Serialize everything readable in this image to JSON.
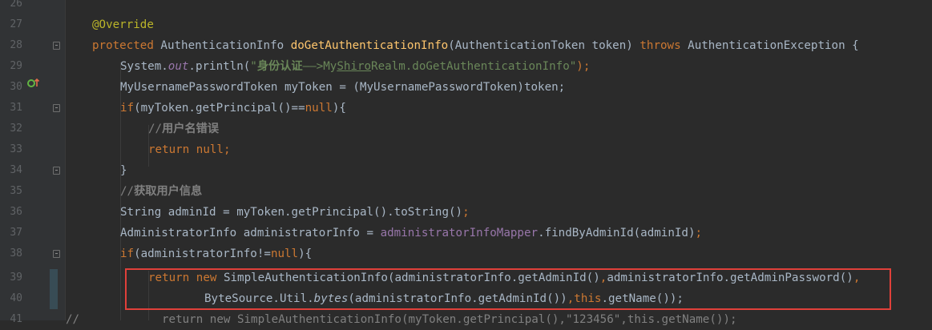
{
  "editor": {
    "line_numbers": [
      "26",
      "27",
      "28",
      "29",
      "30",
      "31",
      "32",
      "33",
      "34",
      "35",
      "36",
      "37",
      "38",
      "39",
      "40",
      "41"
    ],
    "lines": {
      "l27": {
        "annotation": "@Override"
      },
      "l28": {
        "kw": "protected",
        "type": "AuthenticationInfo",
        "method": "doGetAuthenticationInfo",
        "params": "(AuthenticationToken token)",
        "throws": "throws",
        "exc": "AuthenticationException {"
      },
      "l29": {
        "pre": "System.",
        "field": "out",
        "call": ".println(",
        "str_q": "\"",
        "str_cjk": "身份认证",
        "str_arrow": "——>My",
        "str_ul": "Shiro",
        "str_rest": "Realm.doGetAuthenticationInfo\"",
        "end": ");"
      },
      "l30": {
        "text": "MyUsernamePasswordToken myToken = (MyUsernamePasswordToken)token;"
      },
      "l31": {
        "kw": "if",
        "mid": "(myToken.getPrincipal()==",
        "null": "null",
        "end": "){"
      },
      "l32": {
        "slashes": "//",
        "cjk": "用户名错误"
      },
      "l33": {
        "text": "return null;"
      },
      "l34": {
        "text": "}"
      },
      "l35": {
        "slashes": "//",
        "cjk": "获取用户信息"
      },
      "l36": {
        "pre": "String adminId = myToken.getPrincipal().toString()",
        "end": ";"
      },
      "l37": {
        "pre": "AdministratorInfo administratorInfo = ",
        "field": "administratorInfoMapper",
        "post": ".findByAdminId(adminId)",
        "end": ";"
      },
      "l38": {
        "kw": "if",
        "mid": "(administratorInfo!=",
        "null": "null",
        "end": "){"
      },
      "l39": {
        "ret": "return",
        "new": "new",
        "a": " SimpleAuthenticationInfo(administratorInfo.getAdminId()",
        "comma": ",",
        "b": "administratorInfo.getAdminPassword()",
        "comma2": ","
      },
      "l40": {
        "pre": "ByteSource.Util.",
        "it": "bytes",
        "mid": "(administratorInfo.getAdminId())",
        "comma": ",",
        "this": "this",
        "end": ".getName());"
      },
      "l41": {
        "slashes": "//",
        "text": "return new SimpleAuthenticationInfo(myToken.getPrincipal(),\"123456\",this.getName());"
      }
    }
  },
  "colors": {
    "background": "#2b2b2b",
    "keyword": "#cc7832",
    "method": "#ffc66d",
    "string": "#6a8759",
    "field": "#9876aa",
    "highlight_box": "#e0403a"
  }
}
